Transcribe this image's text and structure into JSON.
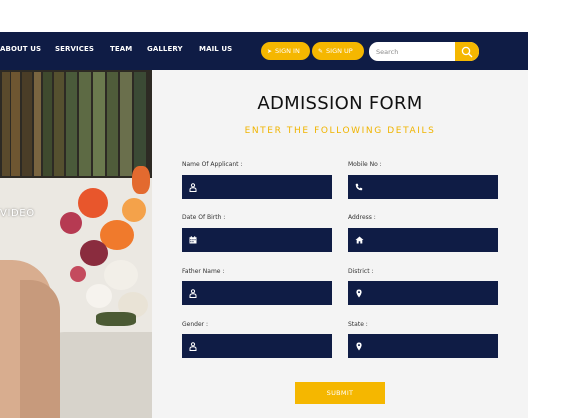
{
  "nav": {
    "items": [
      "ABOUT US",
      "SERVICES",
      "TEAM",
      "GALLERY",
      "MAIL US"
    ],
    "sign_in": "SIGN IN",
    "sign_up": "SIGN UP",
    "search_placeholder": "Search"
  },
  "hero": {
    "video_label": "VIDEO"
  },
  "form": {
    "title": "ADMISSION FORM",
    "subtitle": "ENTER THE FOLLOWING DETAILS",
    "fields": [
      {
        "label": "Name Of Applicant :",
        "icon": "user-icon"
      },
      {
        "label": "Mobile No :",
        "icon": "phone-icon"
      },
      {
        "label": "Date Of Birth :",
        "icon": "calendar-icon"
      },
      {
        "label": "Address :",
        "icon": "home-icon"
      },
      {
        "label": "Father Name :",
        "icon": "user-icon"
      },
      {
        "label": "District :",
        "icon": "map-marker-icon"
      },
      {
        "label": "Gender :",
        "icon": "user-icon"
      },
      {
        "label": "State :",
        "icon": "map-marker-icon"
      }
    ],
    "submit_label": "SUBMIT"
  },
  "colors": {
    "navy": "#0f1c45",
    "accent": "#f5b700",
    "panel": "#f4f4f4"
  }
}
